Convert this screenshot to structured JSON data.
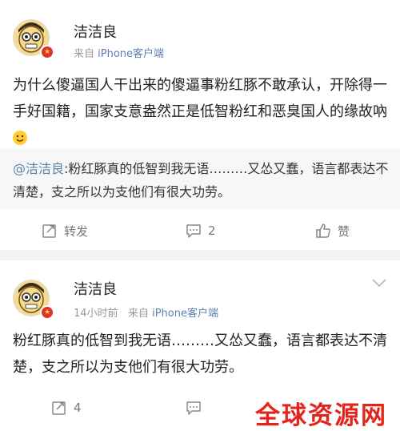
{
  "post1": {
    "username": "洁洁良",
    "source_prefix": "来自",
    "source": "iPhone客户端",
    "content": "为什么傻逼国人干出来的傻逼事粉红豚不敢承认，开除得一手好国籍，国家支意盎然正是低智粉红和恶臭国人的缘故吶",
    "repost_mention": "@洁洁良",
    "repost_text": ":粉红豚真的低智到我无语………又怂又蠢，语言都表达不清楚，支之所以为支他们有很大功劳。",
    "actions": {
      "repost": "转发",
      "comments": "2",
      "like": "赞"
    }
  },
  "post2": {
    "username": "洁洁良",
    "time": "14小时前",
    "source_prefix": "来自",
    "source": "iPhone客户端",
    "content": "粉红豚真的低智到我无语………又怂又蠢，语言都表达不清楚，支之所以为支他们有很大功劳。",
    "actions": {
      "repost_count": "4"
    }
  },
  "watermark": "全球资源网"
}
